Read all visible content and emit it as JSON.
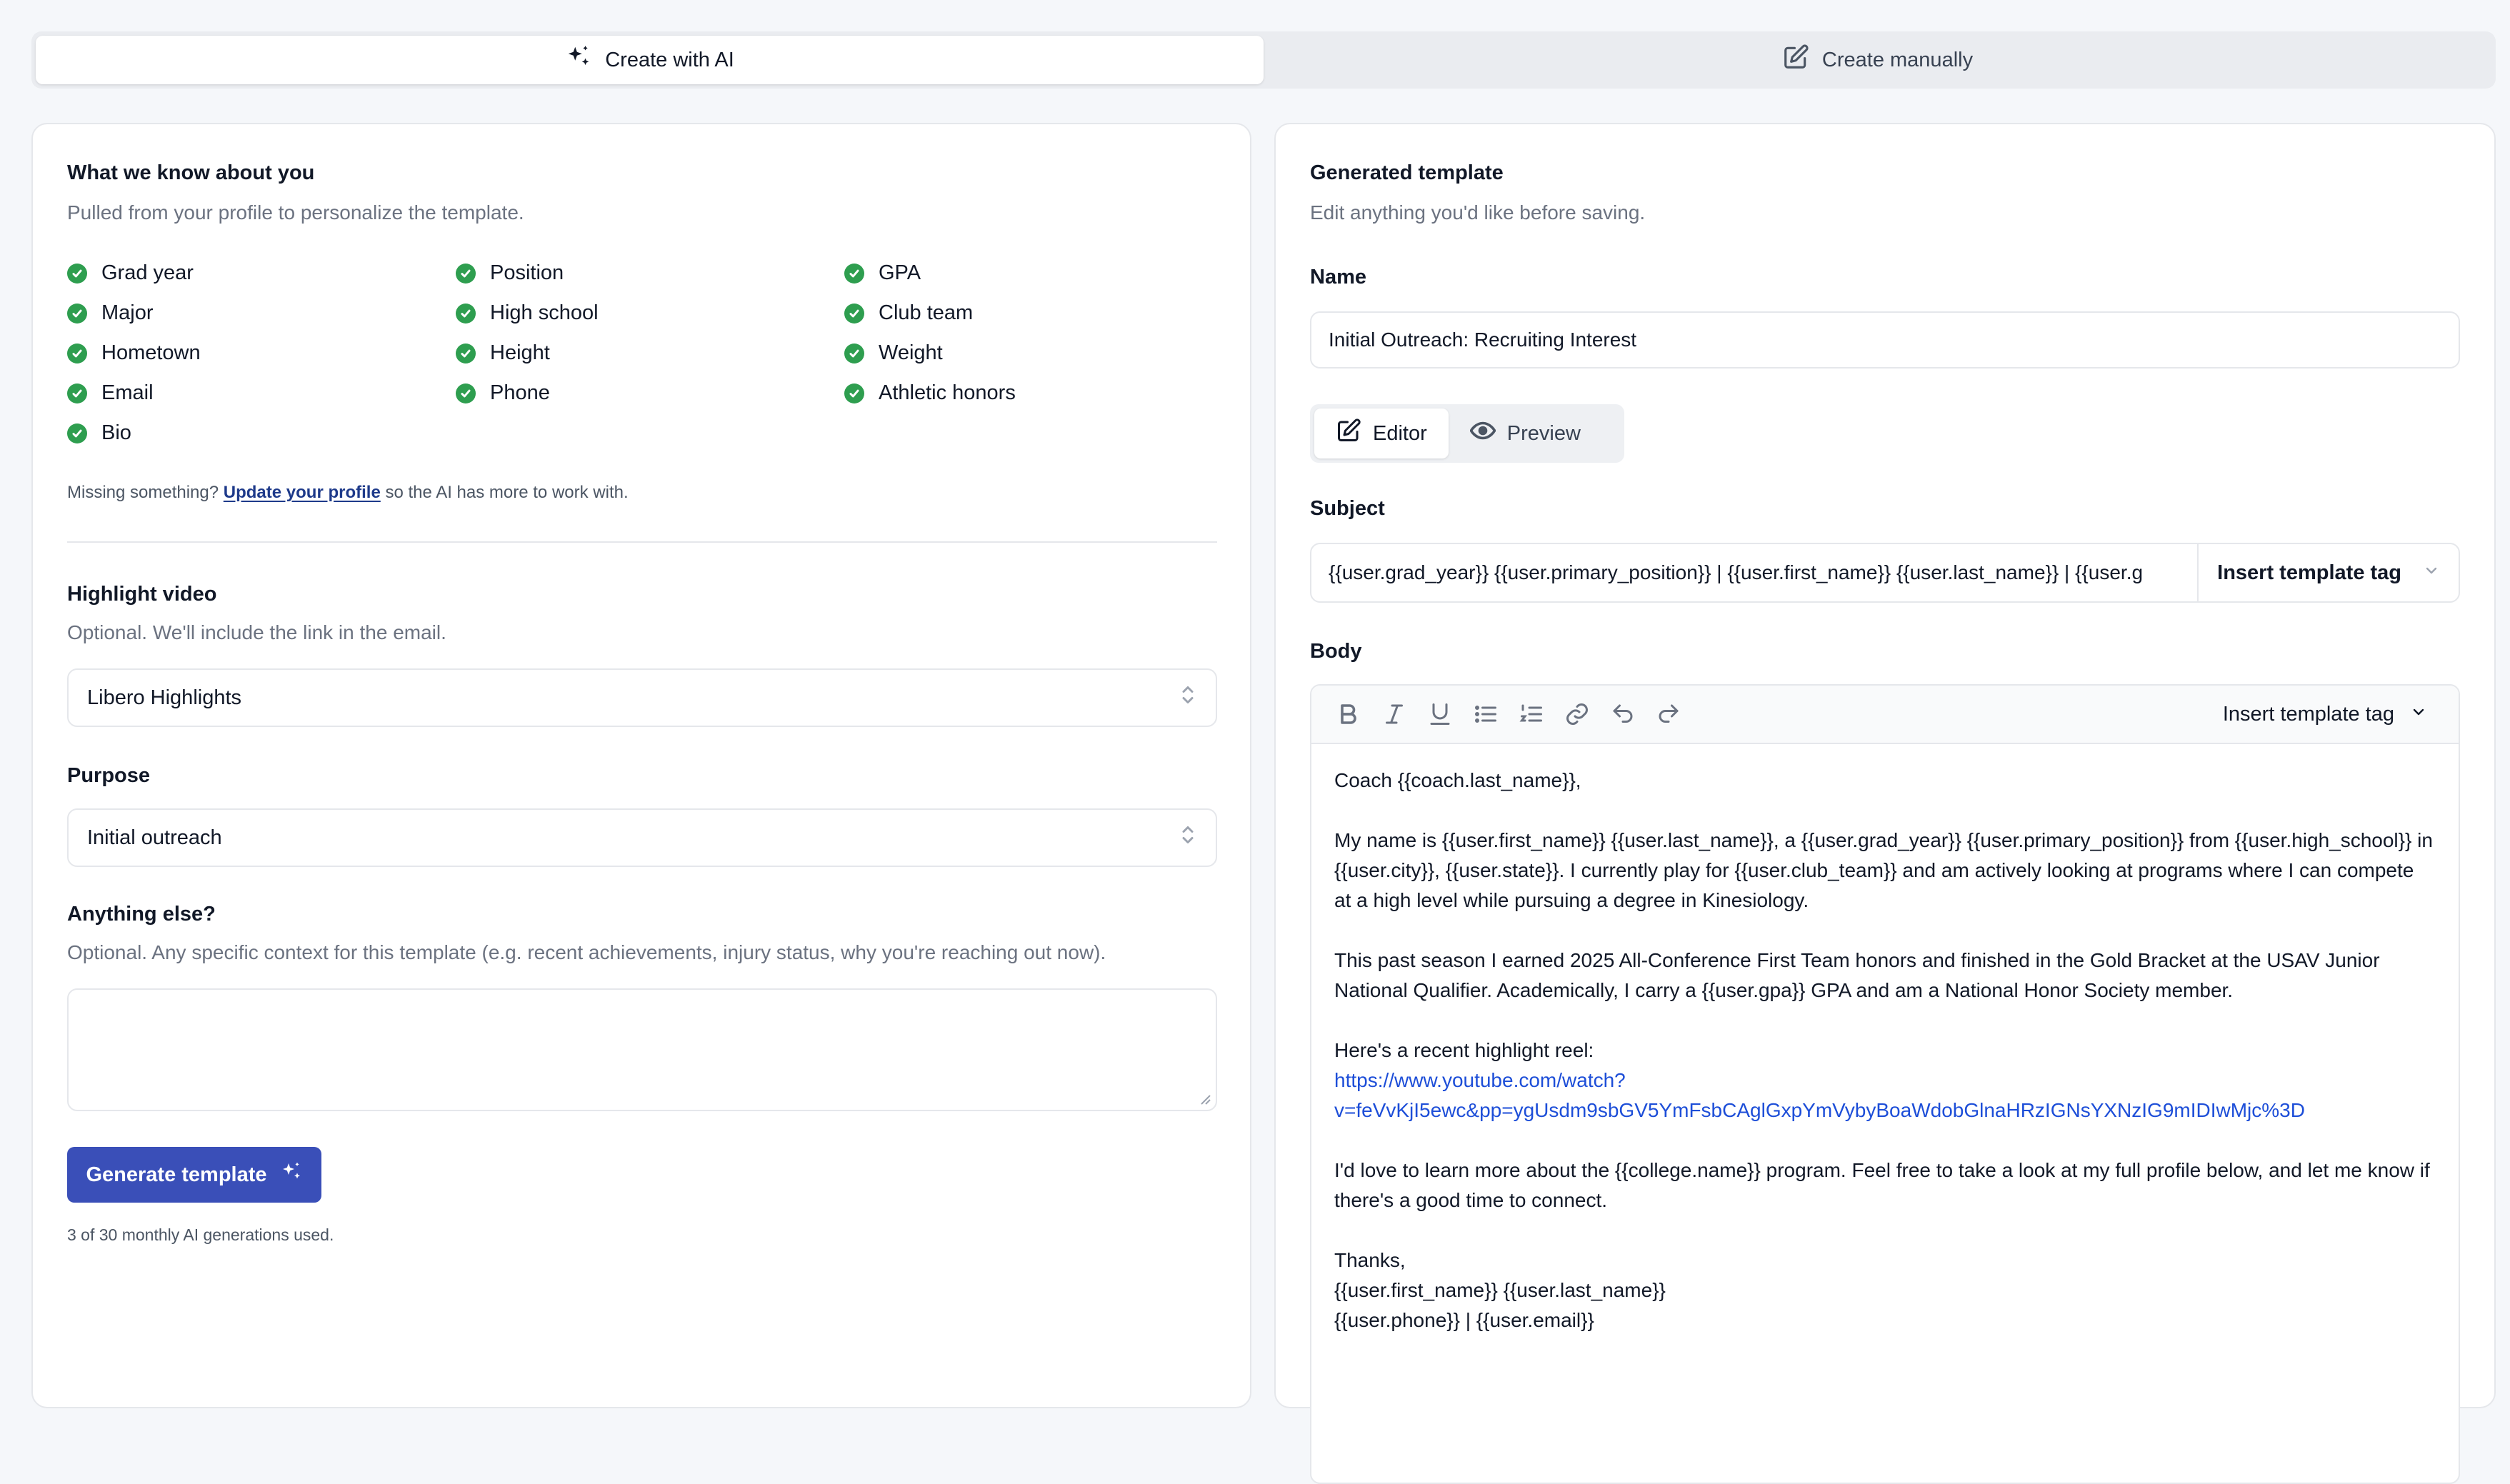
{
  "mode_tabs": {
    "ai": "Create with AI",
    "manual": "Create manually"
  },
  "profile": {
    "title": "What we know about you",
    "subtitle": "Pulled from your profile to personalize the template.",
    "fields": [
      "Grad year",
      "Position",
      "GPA",
      "Major",
      "High school",
      "Club team",
      "Hometown",
      "Height",
      "Weight",
      "Email",
      "Phone",
      "Athletic honors",
      "Bio"
    ],
    "missing_prefix": "Missing something?",
    "missing_link": "Update your profile",
    "missing_suffix": "so the AI has more to work with."
  },
  "video": {
    "label": "Highlight video",
    "help": "Optional. We'll include the link in the email.",
    "selected": "Libero Highlights"
  },
  "purpose": {
    "label": "Purpose",
    "selected": "Initial outreach"
  },
  "anything": {
    "label": "Anything else?",
    "help": "Optional. Any specific context for this template (e.g. recent achievements, injury status, why you're reaching out now).",
    "value": ""
  },
  "generate": {
    "label": "Generate template",
    "usage": "3 of 30 monthly AI generations used."
  },
  "generated": {
    "title": "Generated template",
    "subtitle": "Edit anything you'd like before saving.",
    "name_label": "Name",
    "name_value": "Initial Outreach: Recruiting Interest",
    "tabs": {
      "editor": "Editor",
      "preview": "Preview"
    },
    "subject_label": "Subject",
    "subject_value": "{{user.grad_year}} {{user.primary_position}} | {{user.first_name}} {{user.last_name}} | {{user.g",
    "insert_tag": "Insert template tag",
    "body_label": "Body",
    "body": {
      "greeting": "Coach {{coach.last_name}},",
      "p1": "My name is {{user.first_name}} {{user.last_name}}, a {{user.grad_year}} {{user.primary_position}} from {{user.high_school}} in {{user.city}}, {{user.state}}. I currently play for {{user.club_team}} and am actively looking at programs where I can compete at a high level while pursuing a degree in Kinesiology.",
      "p2": "This past season I earned 2025 All-Conference First Team honors and finished in the Gold Bracket at the USAV Junior National Qualifier. Academically, I carry a {{user.gpa}} GPA and am a National Honor Society member.",
      "reel_intro": "Here's a recent highlight reel:",
      "reel_link_1": "https://www.youtube.com/watch?",
      "reel_link_2": "v=feVvKjI5ewc&pp=ygUsdm9sbGV5YmFsbCAglGxpYmVybyBoaWdobGlnaHRzIGNsYXNzIG9mIDIwMjc%3D",
      "p3": "I'd love to learn more about the {{college.name}} program. Feel free to take a look at my full profile below, and let me know if there's a good time to connect.",
      "signoff": "Thanks,",
      "sig_name": "{{user.first_name}} {{user.last_name}}",
      "sig_contact": "{{user.phone}} | {{user.email}}"
    }
  },
  "colors": {
    "primary_button": "#3a4fb8",
    "check": "#2e9e4f",
    "link": "#1d4ed8"
  }
}
